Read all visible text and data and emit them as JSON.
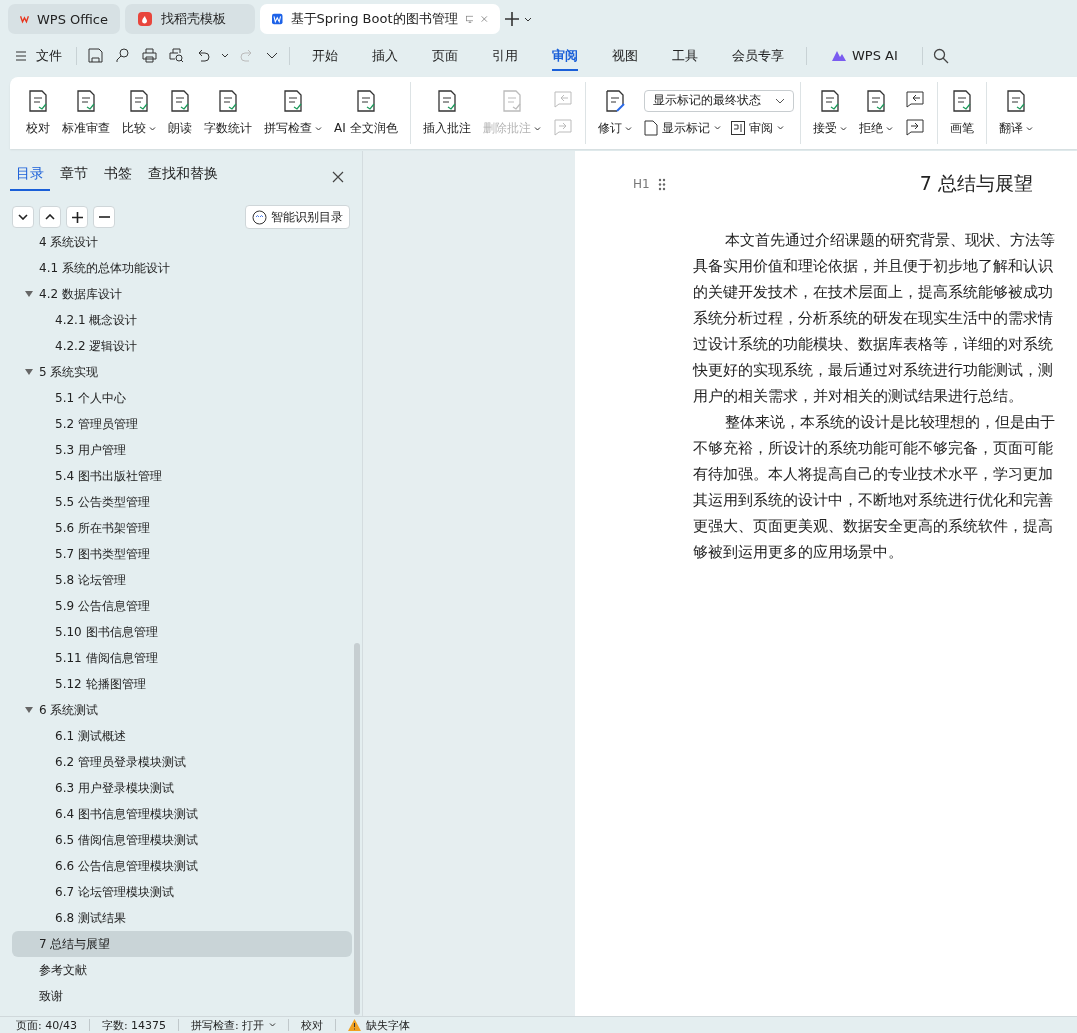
{
  "browser_tabs": [
    {
      "label": "WPS Office",
      "kind": "wps",
      "selected": false
    },
    {
      "label": "找稻壳模板",
      "kind": "docer",
      "selected": false
    },
    {
      "label": "基于Spring Boot的图书管理",
      "kind": "doc",
      "selected": true
    }
  ],
  "menu": {
    "file": "文件",
    "tabs": [
      {
        "label": "开始",
        "selected": false
      },
      {
        "label": "插入",
        "selected": false
      },
      {
        "label": "页面",
        "selected": false
      },
      {
        "label": "引用",
        "selected": false
      },
      {
        "label": "审阅",
        "selected": true
      },
      {
        "label": "视图",
        "selected": false
      },
      {
        "label": "工具",
        "selected": false
      },
      {
        "label": "会员专享",
        "selected": false
      }
    ],
    "ai": "WPS AI"
  },
  "ribbon": [
    {
      "kind": "big",
      "label": "校对",
      "caret": false,
      "disabled": false
    },
    {
      "kind": "big",
      "label": "标准审查",
      "caret": false,
      "disabled": false
    },
    {
      "kind": "big",
      "label": "比较",
      "caret": true,
      "disabled": false
    },
    {
      "kind": "big",
      "label": "朗读",
      "caret": false,
      "disabled": false
    },
    {
      "kind": "big",
      "label": "字数统计",
      "caret": false,
      "disabled": false
    },
    {
      "kind": "big",
      "label": "拼写检查",
      "caret": true,
      "disabled": false
    },
    {
      "kind": "big",
      "label": "AI 全文润色",
      "caret": false,
      "disabled": false
    },
    {
      "kind": "sep"
    },
    {
      "kind": "big",
      "label": "插入批注",
      "caret": false,
      "disabled": false
    },
    {
      "kind": "big",
      "label": "删除批注",
      "caret": true,
      "disabled": true
    },
    {
      "kind": "pair",
      "disabled": true
    },
    {
      "kind": "sep"
    },
    {
      "kind": "track",
      "label": "修订",
      "caret": true,
      "select": "显示标记的最终状态",
      "show": "显示标记",
      "review": "审阅"
    },
    {
      "kind": "sep"
    },
    {
      "kind": "big",
      "label": "接受",
      "caret": true,
      "disabled": false
    },
    {
      "kind": "big",
      "label": "拒绝",
      "caret": true,
      "disabled": false
    },
    {
      "kind": "pair",
      "disabled": false
    },
    {
      "kind": "sep"
    },
    {
      "kind": "big",
      "label": "画笔",
      "caret": false,
      "disabled": false
    },
    {
      "kind": "sep"
    },
    {
      "kind": "big",
      "label": "翻译",
      "caret": true,
      "disabled": false
    }
  ],
  "nav": {
    "tabs": [
      {
        "label": "目录",
        "selected": true
      },
      {
        "label": "章节",
        "selected": false
      },
      {
        "label": "书签",
        "selected": false
      },
      {
        "label": "查找和替换",
        "selected": false
      }
    ],
    "smart_button": "智能识别目录",
    "toc": [
      {
        "label": "4 系统设计",
        "selected": false
      },
      {
        "label": "4.1 系统的总体功能设计",
        "selected": false
      },
      {
        "label": "4.2 数据库设计",
        "selected": false,
        "expanded": true,
        "children": [
          {
            "label": "4.2.1 概念设计",
            "selected": false
          },
          {
            "label": "4.2.2 逻辑设计",
            "selected": false
          }
        ]
      },
      {
        "label": "5 系统实现",
        "selected": false,
        "expanded": true,
        "children": [
          {
            "label": "5.1 个人中心",
            "selected": false
          },
          {
            "label": "5.2 管理员管理",
            "selected": false
          },
          {
            "label": "5.3 用户管理",
            "selected": false
          },
          {
            "label": "5.4 图书出版社管理",
            "selected": false
          },
          {
            "label": "5.5 公告类型管理",
            "selected": false
          },
          {
            "label": "5.6 所在书架管理",
            "selected": false
          },
          {
            "label": "5.7 图书类型管理",
            "selected": false
          },
          {
            "label": "5.8 论坛管理",
            "selected": false
          },
          {
            "label": "5.9 公告信息管理",
            "selected": false
          },
          {
            "label": "5.10 图书信息管理",
            "selected": false
          },
          {
            "label": "5.11 借阅信息管理",
            "selected": false
          },
          {
            "label": "5.12 轮播图管理",
            "selected": false
          }
        ]
      },
      {
        "label": "6 系统测试",
        "selected": false,
        "expanded": true,
        "children": [
          {
            "label": "6.1 测试概述",
            "selected": false
          },
          {
            "label": "6.2 管理员登录模块测试",
            "selected": false
          },
          {
            "label": "6.3 用户登录模块测试",
            "selected": false
          },
          {
            "label": "6.4 图书信息管理模块测试",
            "selected": false
          },
          {
            "label": "6.5 借阅信息管理模块测试",
            "selected": false
          },
          {
            "label": "6.6 公告信息管理模块测试",
            "selected": false
          },
          {
            "label": "6.7 论坛管理模块测试",
            "selected": false
          },
          {
            "label": "6.8 测试结果",
            "selected": false
          }
        ]
      },
      {
        "label": "7 总结与展望",
        "selected": true
      },
      {
        "label": "参考文献",
        "selected": false
      },
      {
        "label": "致谢",
        "selected": false
      }
    ]
  },
  "document": {
    "heading_marker": "H1",
    "heading": "7 总结与展望",
    "paragraphs": [
      [
        "本文首先通过介绍课题的研究背景、现状、方法等",
        "具备实用价值和理论依据，并且便于初步地了解和认识",
        "的关键开发技术，在技术层面上，提高系统能够被成功",
        "系统分析过程，分析系统的研发在现实生活中的需求情",
        "过设计系统的功能模块、数据库表格等，详细的对系统",
        "快更好的实现系统，最后通过对系统进行功能测试，测",
        "用户的相关需求，并对相关的测试结果进行总结。"
      ],
      [
        "整体来说，本系统的设计是比较理想的，但是由于",
        "不够充裕，所设计的系统功能可能不够完备，页面可能",
        "有待加强。本人将提高自己的专业技术水平，学习更加",
        "其运用到系统的设计中，不断地对系统进行优化和完善",
        "更强大、页面更美观、数据安全更高的系统软件，提高",
        "够被到运用更多的应用场景中。"
      ]
    ]
  },
  "status_bar": [
    {
      "kind": "text",
      "label": "页面: 40/43"
    },
    {
      "kind": "text",
      "label": "字数: 14375"
    },
    {
      "kind": "menu",
      "label": "拼写检查: 打开"
    },
    {
      "kind": "text",
      "label": "校对"
    },
    {
      "kind": "warning",
      "label": "缺失字体"
    }
  ]
}
